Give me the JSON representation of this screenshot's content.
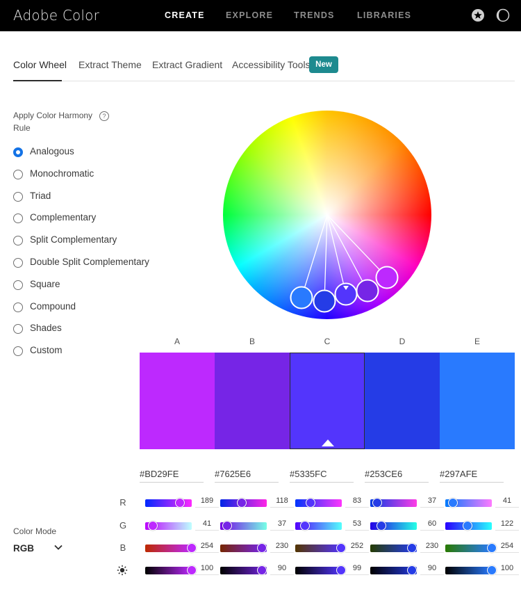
{
  "app": {
    "brand": "Adobe Color",
    "nav": [
      {
        "label": "CREATE",
        "active": true
      },
      {
        "label": "EXPLORE",
        "active": false
      },
      {
        "label": "TRENDS",
        "active": false
      },
      {
        "label": "LIBRARIES",
        "active": false
      }
    ],
    "icons": [
      "star-badge-icon",
      "theme-toggle-icon"
    ]
  },
  "tabs": [
    {
      "label": "Color Wheel",
      "active": true
    },
    {
      "label": "Extract Theme",
      "active": false
    },
    {
      "label": "Extract Gradient",
      "active": false
    },
    {
      "label": "Accessibility Tools",
      "active": false
    }
  ],
  "new_badge": "New",
  "harmony": {
    "title": "Apply Color Harmony Rule",
    "help_glyph": "?",
    "selected": "Analogous",
    "rules": [
      "Analogous",
      "Monochromatic",
      "Triad",
      "Complementary",
      "Split Complementary",
      "Double Split Complementary",
      "Square",
      "Compound",
      "Shades",
      "Custom"
    ]
  },
  "swatches": [
    {
      "label": "A",
      "hex": "#BD29FE",
      "color": "#BD29FE",
      "r": "189",
      "g": "41",
      "b": "254",
      "brightness": "100"
    },
    {
      "label": "B",
      "hex": "#7625E6",
      "color": "#7625E6",
      "r": "118",
      "g": "37",
      "b": "230",
      "brightness": "90"
    },
    {
      "label": "C",
      "hex": "#5335FC",
      "color": "#5335FC",
      "r": "83",
      "g": "53",
      "b": "252",
      "brightness": "99"
    },
    {
      "label": "D",
      "hex": "#253CE6",
      "color": "#253CE6",
      "r": "37",
      "g": "60",
      "b": "230",
      "brightness": "90"
    },
    {
      "label": "E",
      "hex": "#297AFE",
      "color": "#297AFE",
      "r": "41",
      "g": "122",
      "b": "254",
      "brightness": "100"
    }
  ],
  "selected_swatch": "C",
  "rows": [
    {
      "key": "r",
      "label": "R"
    },
    {
      "key": "g",
      "label": "G"
    },
    {
      "key": "b",
      "label": "B"
    },
    {
      "key": "brightness",
      "label": "",
      "icon": "brightness-icon"
    }
  ],
  "color_mode": {
    "label": "Color Mode",
    "value": "RGB"
  },
  "colors": {
    "accent": "#1473e6",
    "badge": "#1d8a8f",
    "topbar": "#000000"
  }
}
